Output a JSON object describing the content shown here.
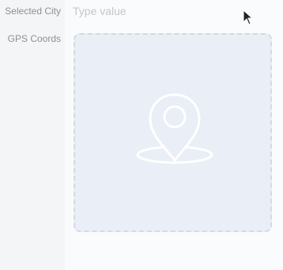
{
  "form": {
    "selected_city": {
      "label": "Selected City",
      "value": "",
      "placeholder": "Type value"
    },
    "gps_coords": {
      "label": "GPS Coords",
      "icon": "map-pin-icon"
    }
  }
}
